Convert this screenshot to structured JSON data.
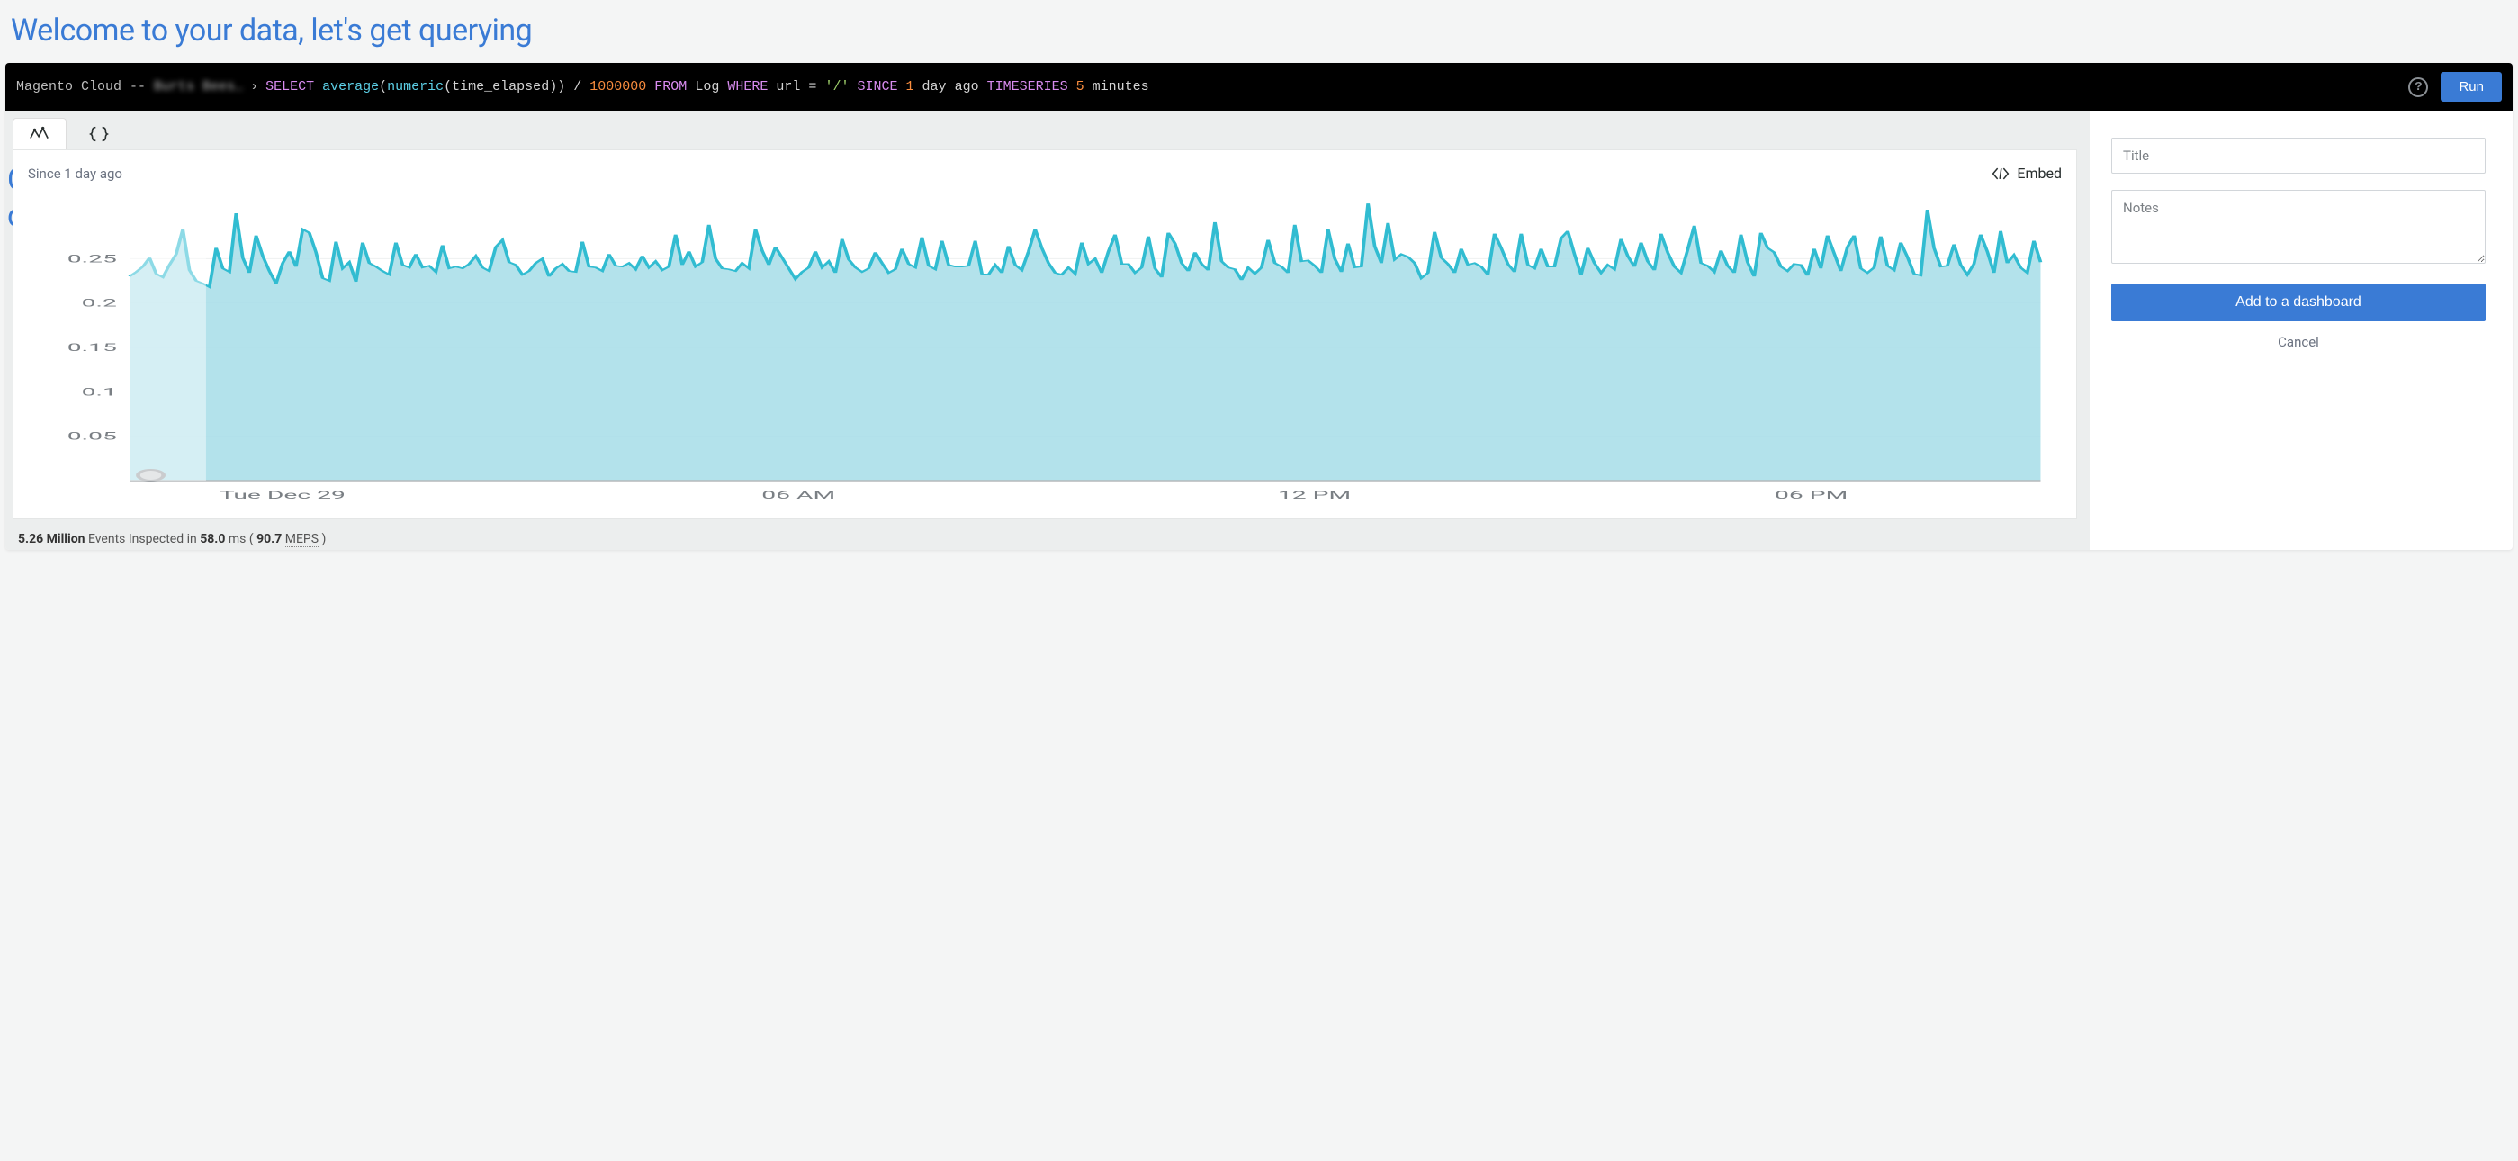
{
  "header": {
    "title": "Welcome to your data, let's get querying"
  },
  "bg_fragments": {
    "c": "C",
    "d": "d"
  },
  "query_bar": {
    "account_prefix": "Magento Cloud -- ",
    "account_blurred": "Burts Bees…",
    "caret": "›",
    "tokens": [
      {
        "text": "SELECT",
        "cls": "kw"
      },
      {
        "text": "average",
        "cls": "fn"
      },
      {
        "text": "(",
        "cls": "paren",
        "nospace": true
      },
      {
        "text": "numeric",
        "cls": "fn",
        "nospace": true
      },
      {
        "text": "(",
        "cls": "paren",
        "nospace": true
      },
      {
        "text": "time_elapsed",
        "cls": "id",
        "nospace": true
      },
      {
        "text": "))",
        "cls": "paren",
        "nospace": true
      },
      {
        "text": "/",
        "cls": "op"
      },
      {
        "text": "1000000",
        "cls": "num"
      },
      {
        "text": "FROM",
        "cls": "kw"
      },
      {
        "text": "Log",
        "cls": "id"
      },
      {
        "text": "WHERE",
        "cls": "kw"
      },
      {
        "text": "url",
        "cls": "id"
      },
      {
        "text": "=",
        "cls": "op"
      },
      {
        "text": "'/'",
        "cls": "str"
      },
      {
        "text": "SINCE",
        "cls": "kw"
      },
      {
        "text": "1",
        "cls": "num"
      },
      {
        "text": "day",
        "cls": "id"
      },
      {
        "text": "ago",
        "cls": "id"
      },
      {
        "text": "TIMESERIES",
        "cls": "kw"
      },
      {
        "text": "5",
        "cls": "num"
      },
      {
        "text": "minutes",
        "cls": "id"
      }
    ],
    "help_tooltip": "?",
    "run_label": "Run"
  },
  "chart": {
    "since_label": "Since 1 day ago",
    "embed_label": "Embed"
  },
  "chart_data": {
    "type": "area",
    "title": "",
    "xlabel": "",
    "ylabel": "",
    "ylim": [
      0,
      0.3
    ],
    "y_ticks": [
      0.05,
      0.1,
      0.15,
      0.2,
      0.25
    ],
    "x_ticks": [
      "Tue Dec 29",
      "06 AM",
      "12 PM",
      "06 PM"
    ],
    "x": [
      0,
      1,
      2,
      3,
      4,
      5,
      6,
      7,
      8,
      9,
      10,
      11,
      12,
      13,
      14,
      15,
      16,
      17,
      18,
      19,
      20,
      21,
      22,
      23,
      24,
      25,
      26,
      27,
      28,
      29,
      30,
      31,
      32,
      33,
      34,
      35,
      36,
      37,
      38,
      39,
      40,
      41,
      42,
      43,
      44,
      45,
      46,
      47,
      48,
      49,
      50,
      51,
      52,
      53,
      54,
      55,
      56,
      57,
      58,
      59,
      60,
      61,
      62,
      63,
      64,
      65,
      66,
      67,
      68,
      69,
      70,
      71,
      72,
      73,
      74,
      75,
      76,
      77,
      78,
      79,
      80,
      81,
      82,
      83,
      84,
      85,
      86,
      87,
      88,
      89,
      90,
      91,
      92,
      93,
      94,
      95,
      96,
      97,
      98,
      99,
      100,
      101,
      102,
      103,
      104,
      105,
      106,
      107,
      108,
      109,
      110,
      111,
      112,
      113,
      114,
      115,
      116,
      117,
      118,
      119,
      120,
      121,
      122,
      123,
      124,
      125,
      126,
      127,
      128,
      129,
      130,
      131,
      132,
      133,
      134,
      135,
      136,
      137,
      138,
      139,
      140,
      141,
      142,
      143,
      144,
      145,
      146,
      147,
      148,
      149,
      150,
      151,
      152,
      153,
      154,
      155,
      156,
      157,
      158,
      159,
      160,
      161,
      162,
      163,
      164,
      165,
      166,
      167,
      168,
      169,
      170,
      171,
      172,
      173,
      174,
      175,
      176,
      177,
      178,
      179,
      180,
      181,
      182,
      183,
      184,
      185,
      186,
      187,
      188,
      189,
      190,
      191,
      192,
      193,
      194,
      195,
      196,
      197,
      198,
      199,
      200,
      201,
      202,
      203,
      204,
      205,
      206,
      207,
      208,
      209,
      210,
      211,
      212,
      213,
      214,
      215,
      216,
      217,
      218,
      219,
      220,
      221,
      222,
      223,
      224,
      225,
      226,
      227,
      228,
      229,
      230,
      231,
      232,
      233,
      234,
      235,
      236,
      237,
      238,
      239,
      240,
      241,
      242,
      243,
      244,
      245,
      246,
      247,
      248,
      249,
      250,
      251,
      252,
      253,
      254,
      255,
      256,
      257,
      258,
      259,
      260,
      261,
      262,
      263,
      264,
      265,
      266,
      267,
      268,
      269,
      270,
      271,
      272,
      273,
      274,
      275,
      276,
      277,
      278,
      279,
      280,
      281,
      282,
      283,
      284,
      285,
      286,
      287
    ],
    "values": [
      0.23,
      0.235,
      0.241,
      0.251,
      0.233,
      0.229,
      0.243,
      0.255,
      0.283,
      0.237,
      0.225,
      0.222,
      0.218,
      0.262,
      0.239,
      0.235,
      0.301,
      0.251,
      0.234,
      0.276,
      0.253,
      0.236,
      0.222,
      0.245,
      0.258,
      0.241,
      0.283,
      0.279,
      0.257,
      0.228,
      0.225,
      0.269,
      0.239,
      0.246,
      0.224,
      0.268,
      0.245,
      0.241,
      0.236,
      0.232,
      0.268,
      0.243,
      0.24,
      0.255,
      0.24,
      0.242,
      0.235,
      0.265,
      0.239,
      0.241,
      0.239,
      0.244,
      0.253,
      0.24,
      0.236,
      0.263,
      0.271,
      0.246,
      0.243,
      0.232,
      0.236,
      0.245,
      0.25,
      0.23,
      0.239,
      0.244,
      0.236,
      0.235,
      0.269,
      0.241,
      0.24,
      0.236,
      0.255,
      0.242,
      0.241,
      0.245,
      0.238,
      0.253,
      0.24,
      0.247,
      0.237,
      0.241,
      0.277,
      0.243,
      0.258,
      0.241,
      0.246,
      0.288,
      0.25,
      0.239,
      0.238,
      0.236,
      0.245,
      0.239,
      0.283,
      0.259,
      0.243,
      0.263,
      0.251,
      0.239,
      0.227,
      0.235,
      0.24,
      0.258,
      0.24,
      0.247,
      0.234,
      0.272,
      0.249,
      0.24,
      0.235,
      0.239,
      0.257,
      0.245,
      0.234,
      0.238,
      0.261,
      0.244,
      0.24,
      0.274,
      0.242,
      0.238,
      0.27,
      0.243,
      0.241,
      0.241,
      0.242,
      0.27,
      0.233,
      0.232,
      0.243,
      0.234,
      0.264,
      0.243,
      0.237,
      0.258,
      0.283,
      0.262,
      0.245,
      0.234,
      0.232,
      0.24,
      0.233,
      0.268,
      0.244,
      0.25,
      0.234,
      0.258,
      0.277,
      0.244,
      0.244,
      0.234,
      0.24,
      0.275,
      0.239,
      0.229,
      0.279,
      0.267,
      0.245,
      0.236,
      0.257,
      0.244,
      0.237,
      0.291,
      0.247,
      0.24,
      0.238,
      0.226,
      0.24,
      0.233,
      0.24,
      0.271,
      0.245,
      0.241,
      0.234,
      0.288,
      0.247,
      0.248,
      0.242,
      0.234,
      0.283,
      0.25,
      0.235,
      0.267,
      0.24,
      0.241,
      0.312,
      0.264,
      0.245,
      0.29,
      0.249,
      0.255,
      0.252,
      0.245,
      0.228,
      0.234,
      0.28,
      0.251,
      0.244,
      0.234,
      0.261,
      0.243,
      0.245,
      0.241,
      0.232,
      0.278,
      0.262,
      0.244,
      0.235,
      0.278,
      0.243,
      0.239,
      0.261,
      0.241,
      0.241,
      0.273,
      0.281,
      0.255,
      0.232,
      0.262,
      0.245,
      0.234,
      0.243,
      0.238,
      0.272,
      0.253,
      0.241,
      0.268,
      0.247,
      0.237,
      0.278,
      0.257,
      0.241,
      0.234,
      0.26,
      0.287,
      0.245,
      0.242,
      0.235,
      0.259,
      0.242,
      0.234,
      0.277,
      0.246,
      0.23,
      0.279,
      0.262,
      0.257,
      0.241,
      0.236,
      0.244,
      0.243,
      0.231,
      0.261,
      0.239,
      0.276,
      0.256,
      0.236,
      0.263,
      0.276,
      0.239,
      0.234,
      0.24,
      0.275,
      0.242,
      0.237,
      0.268,
      0.252,
      0.233,
      0.231,
      0.305,
      0.262,
      0.241,
      0.242,
      0.266,
      0.243,
      0.232,
      0.244,
      0.277,
      0.258,
      0.234,
      0.281,
      0.245,
      0.254,
      0.24,
      0.234,
      0.27,
      0.246
    ],
    "color": "#31bcd1",
    "fill_color": "#a6dde8"
  },
  "footer": {
    "count_value": "5.26 Million",
    "count_label": " Events Inspected in ",
    "ms_value": "58.0",
    "ms_label": " ms ( ",
    "rate_value": "90.7 ",
    "rate_unit": "MEPS",
    "close": " )"
  },
  "side": {
    "title_placeholder": "Title",
    "notes_placeholder": "Notes",
    "add_label": "Add to a dashboard",
    "cancel_label": "Cancel"
  }
}
